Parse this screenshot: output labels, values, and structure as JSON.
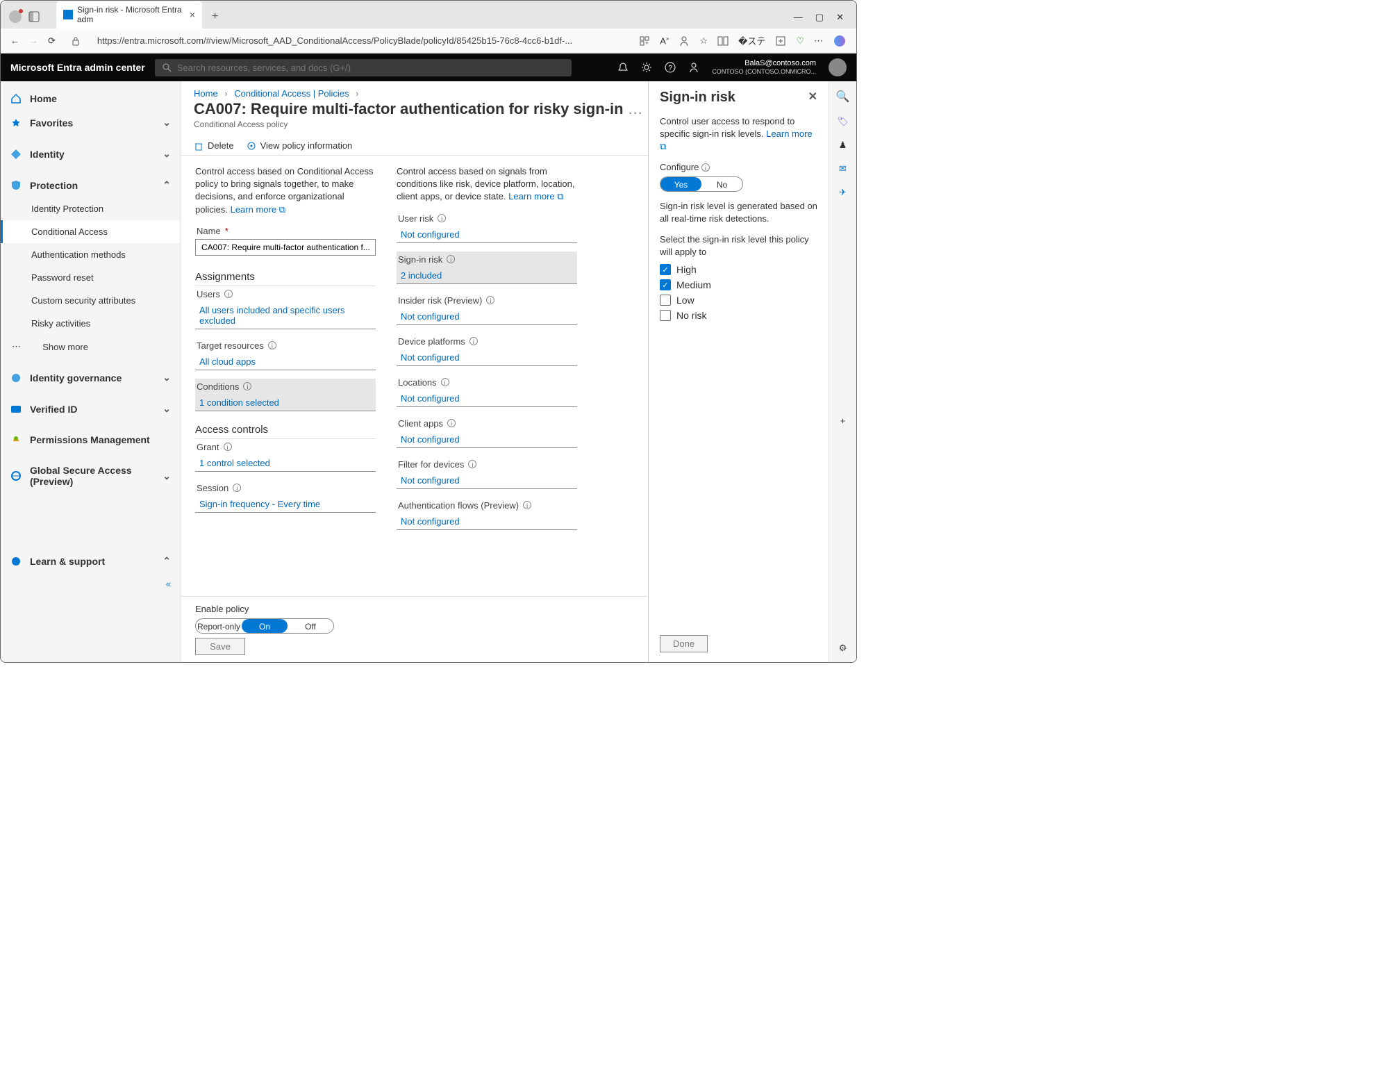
{
  "browser": {
    "tab_title": "Sign-in risk - Microsoft Entra adm",
    "url": "https://entra.microsoft.com/#view/Microsoft_AAD_ConditionalAccess/PolicyBlade/policyId/85425b15-76c8-4cc6-b1df-..."
  },
  "topbar": {
    "brand": "Microsoft Entra admin center",
    "search_placeholder": "Search resources, services, and docs (G+/)",
    "account_email": "BalaS@contoso.com",
    "account_dir": "CONTOSO (CONTOSO.ONMICRO..."
  },
  "nav": {
    "home": "Home",
    "favorites": "Favorites",
    "identity": "Identity",
    "protection": "Protection",
    "protection_children": [
      "Identity Protection",
      "Conditional Access",
      "Authentication methods",
      "Password reset",
      "Custom security attributes",
      "Risky activities",
      "Show more"
    ],
    "idgov": "Identity governance",
    "verified": "Verified ID",
    "perm": "Permissions Management",
    "gsa": "Global Secure Access (Preview)",
    "learn": "Learn & support"
  },
  "crumbs": {
    "home": "Home",
    "c1": "Conditional Access | Policies"
  },
  "page": {
    "title": "CA007: Require multi-factor authentication for risky sign-in",
    "subtitle": "Conditional Access policy",
    "delete": "Delete",
    "viewinfo": "View policy information"
  },
  "left": {
    "intro": "Control access based on Conditional Access policy to bring signals together, to make decisions, and enforce organizational policies.",
    "learn": "Learn more",
    "name_label": "Name",
    "name_value": "CA007: Require multi-factor authentication f...",
    "assignments": "Assignments",
    "users_label": "Users",
    "users_val": "All users included and specific users excluded",
    "targets_label": "Target resources",
    "targets_val": "All cloud apps",
    "conditions_label": "Conditions",
    "conditions_val": "1 condition selected",
    "access_controls": "Access controls",
    "grant_label": "Grant",
    "grant_val": "1 control selected",
    "session_label": "Session",
    "session_val": "Sign-in frequency - Every time"
  },
  "right": {
    "intro": "Control access based on signals from conditions like risk, device platform, location, client apps, or device state.",
    "learn": "Learn more",
    "user_risk": "User risk",
    "user_risk_val": "Not configured",
    "signin_risk": "Sign-in risk",
    "signin_risk_val": "2 included",
    "insider": "Insider risk (Preview)",
    "insider_val": "Not configured",
    "device": "Device platforms",
    "device_val": "Not configured",
    "locations": "Locations",
    "locations_val": "Not configured",
    "clientapps": "Client apps",
    "clientapps_val": "Not configured",
    "filter": "Filter for devices",
    "filter_val": "Not configured",
    "authflows": "Authentication flows (Preview)",
    "authflows_val": "Not configured"
  },
  "panel": {
    "title": "Sign-in risk",
    "desc": "Control user access to respond to specific sign-in risk levels.",
    "learn": "Learn more",
    "configure": "Configure",
    "yes": "Yes",
    "no": "No",
    "note": "Sign-in risk level is generated based on all real-time risk detections.",
    "select": "Select the sign-in risk level this policy will apply to",
    "options": [
      {
        "label": "High",
        "checked": true
      },
      {
        "label": "Medium",
        "checked": true
      },
      {
        "label": "Low",
        "checked": false
      },
      {
        "label": "No risk",
        "checked": false
      }
    ],
    "done": "Done"
  },
  "footer": {
    "enable": "Enable policy",
    "opts": [
      "Report-only",
      "On",
      "Off"
    ],
    "active": 1,
    "save": "Save"
  }
}
